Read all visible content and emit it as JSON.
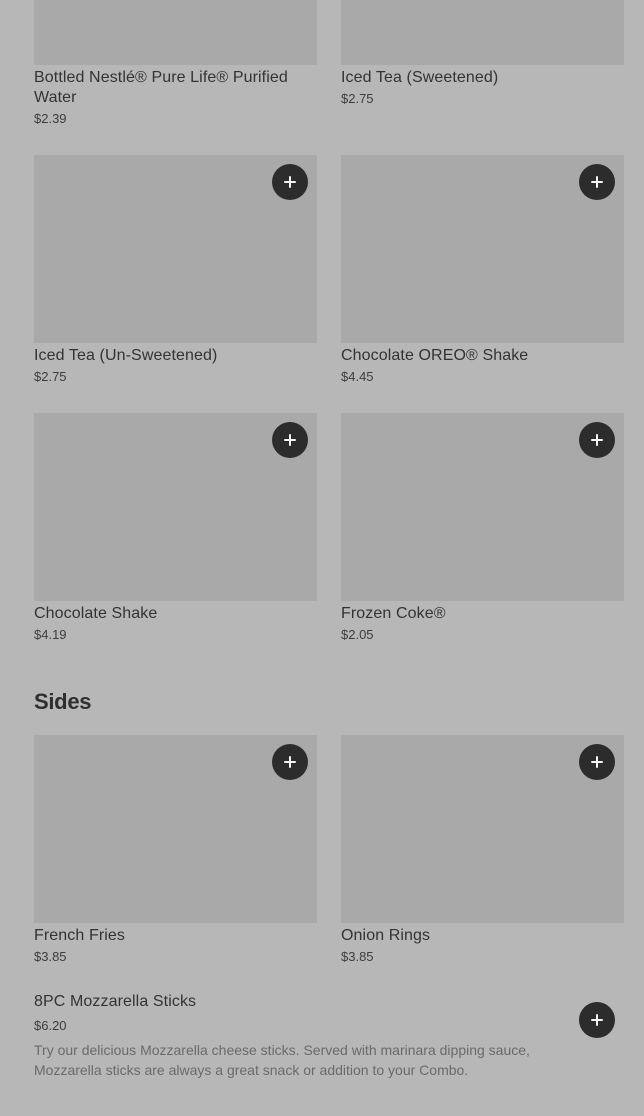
{
  "drinks": [
    {
      "name": "Bottled Nestlé® Pure Life® Purified Water",
      "price": "$2.39"
    },
    {
      "name": "Iced Tea (Sweetened)",
      "price": "$2.75"
    },
    {
      "name": "Iced Tea (Un-Sweetened)",
      "price": "$2.75"
    },
    {
      "name": "Chocolate OREO® Shake",
      "price": "$4.45"
    },
    {
      "name": "Chocolate Shake",
      "price": "$4.19"
    },
    {
      "name": "Frozen Coke®",
      "price": "$2.05"
    }
  ],
  "sides": {
    "title": "Sides",
    "items": [
      {
        "name": "French Fries",
        "price": "$3.85"
      },
      {
        "name": "Onion Rings",
        "price": "$3.85"
      }
    ],
    "list_item": {
      "name": "8PC Mozzarella Sticks",
      "price": "$6.20",
      "description": "Try our delicious Mozzarella cheese sticks. Served with marinara dipping sauce, Mozzarella sticks are always a great snack or addition to your Combo."
    }
  },
  "icons": {
    "add": "plus-icon"
  },
  "colors": {
    "background": "#b7b7b7",
    "image_placeholder": "#a9a9a9",
    "add_button": "#2c2c2c"
  }
}
